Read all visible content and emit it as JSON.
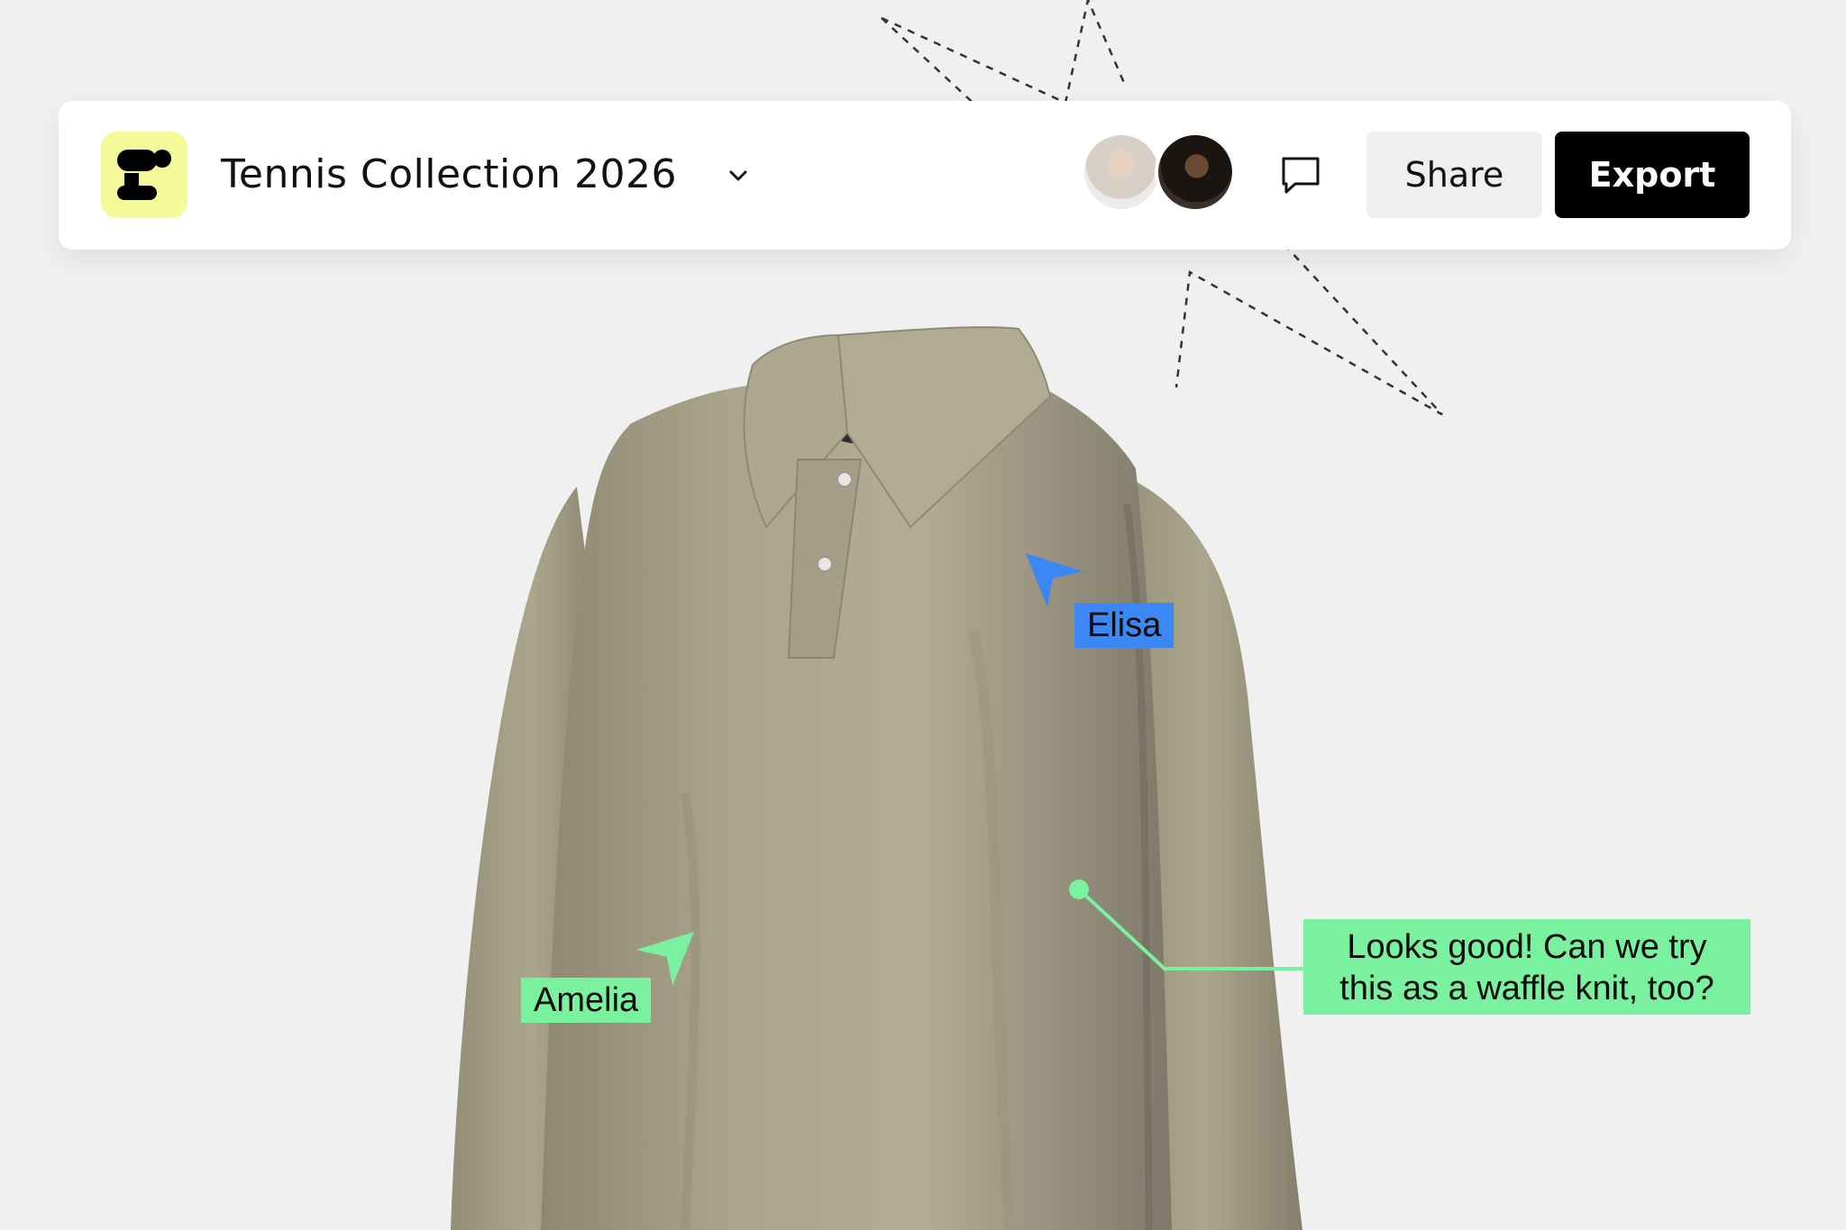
{
  "header": {
    "project_title": "Tennis Collection 2026",
    "share_label": "Share",
    "export_label": "Export"
  },
  "collaborators": [
    {
      "name": "Elisa",
      "color": "#3b87f4"
    },
    {
      "name": "Amelia",
      "color": "#79f19f"
    }
  ],
  "comment": {
    "line1": "Looks good! Can we try",
    "line2": "this as a waffle knit, too?",
    "color": "#79f19f"
  },
  "icons": {
    "logo": "logo-icon",
    "dropdown": "chevron-down-icon",
    "comments": "speech-bubble-icon"
  },
  "colors": {
    "logo_bg": "#f6f99a",
    "export_bg": "#000000",
    "share_bg": "#efefef",
    "garment": "#a9a38b"
  }
}
